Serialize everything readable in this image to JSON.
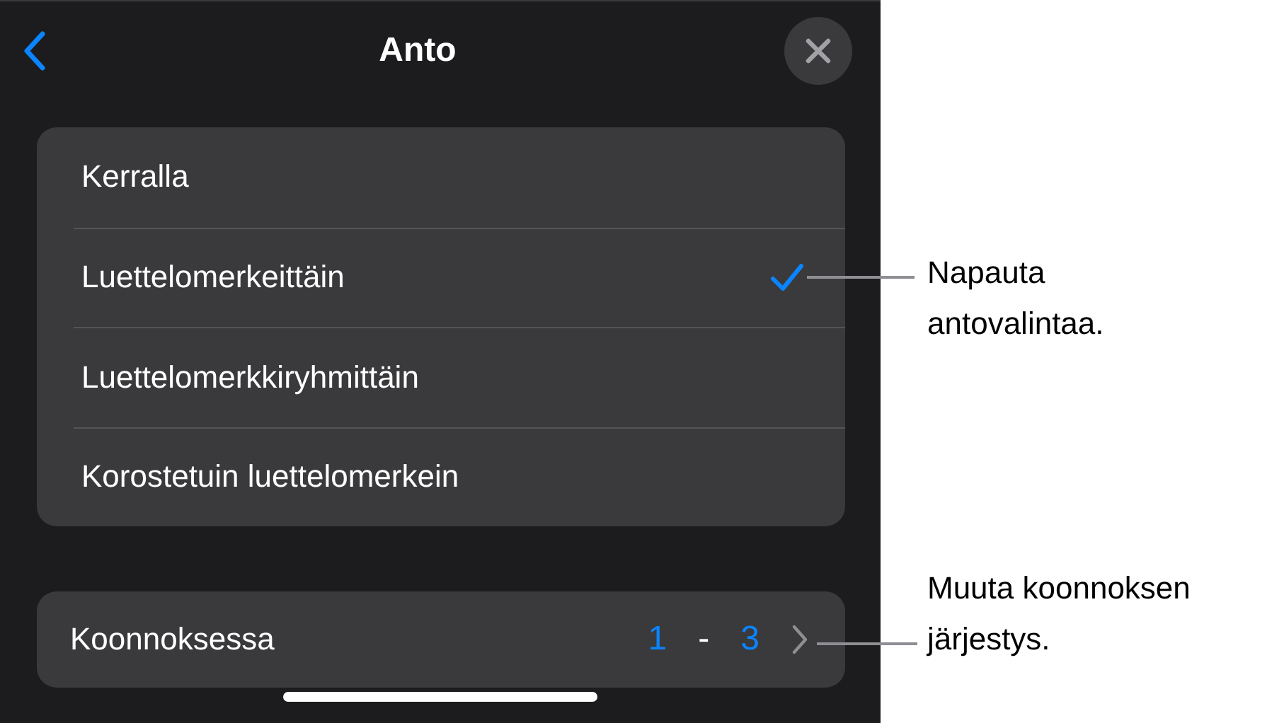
{
  "header": {
    "title": "Anto"
  },
  "options": [
    {
      "label": "Kerralla",
      "selected": false
    },
    {
      "label": "Luettelomerkeittäin",
      "selected": true
    },
    {
      "label": "Luettelomerkkiryhmittäin",
      "selected": false
    },
    {
      "label": "Korostetuin luettelomerkein",
      "selected": false
    }
  ],
  "order": {
    "label": "Koonnoksessa",
    "from": "1",
    "separator": "-",
    "to": "3"
  },
  "callouts": [
    {
      "text": "Napauta\nantovalintaa."
    },
    {
      "text": "Muuta koonnoksen\njärjestys."
    }
  ]
}
